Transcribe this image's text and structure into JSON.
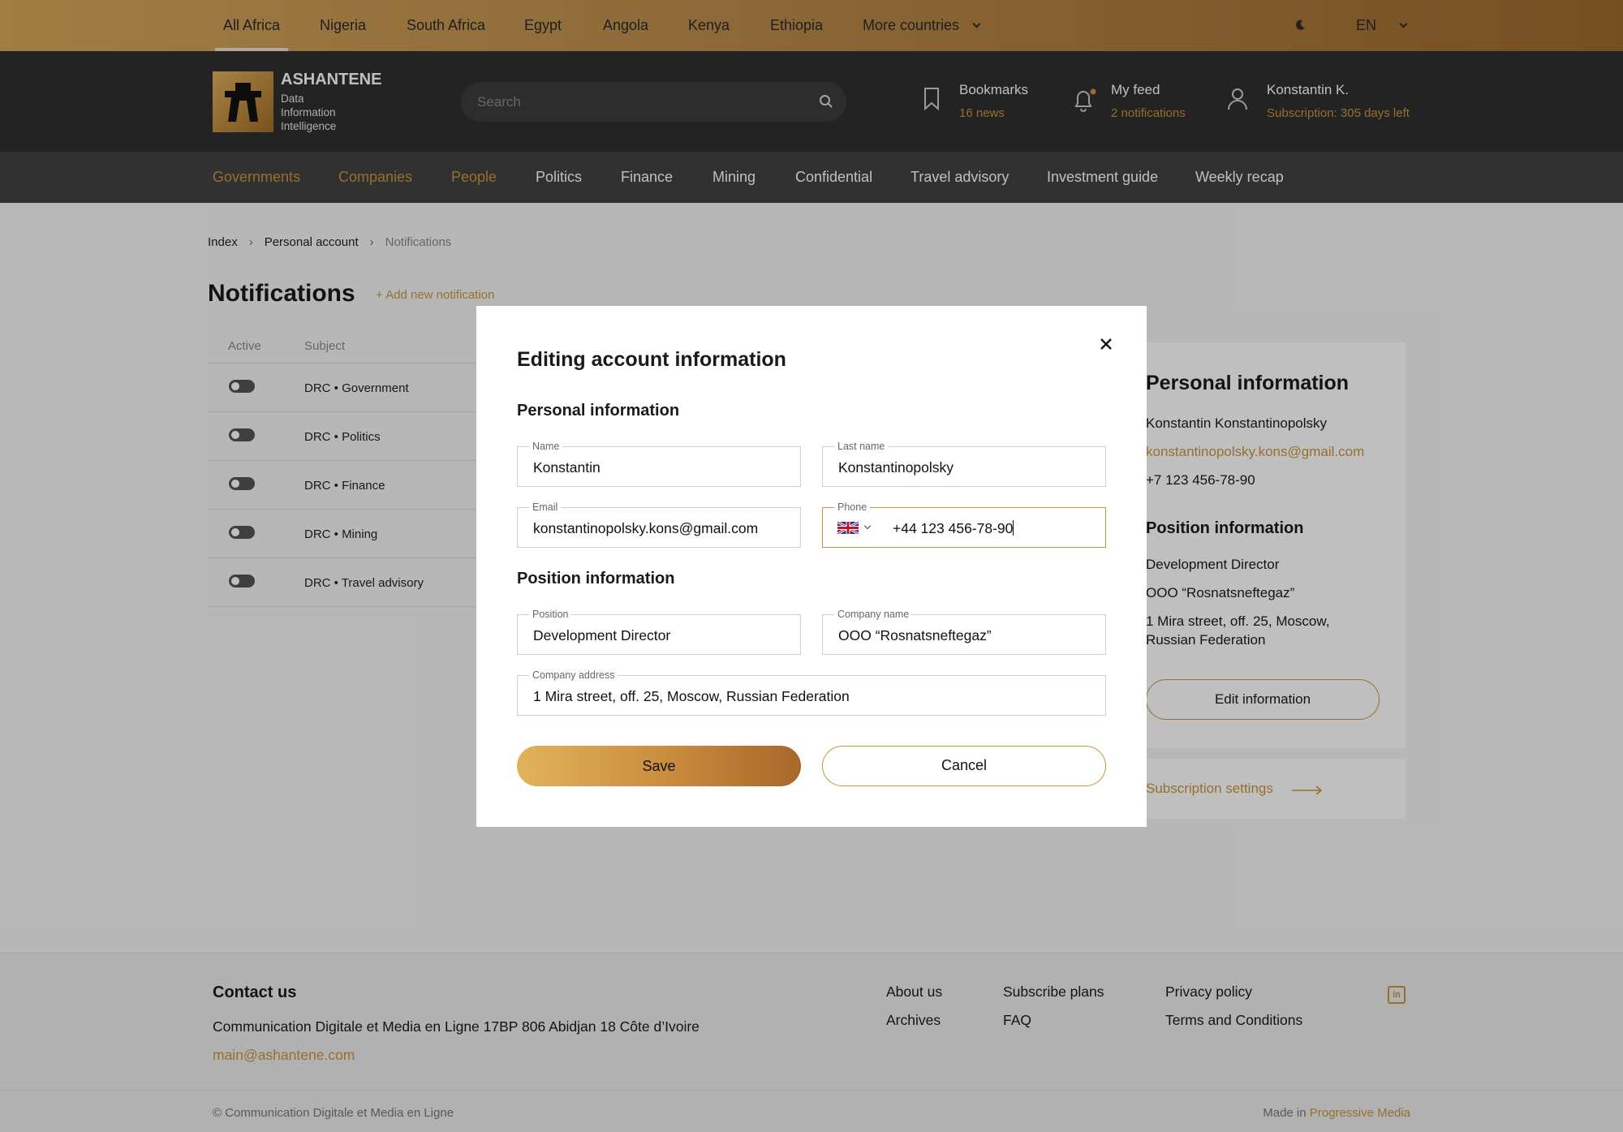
{
  "country_bar": {
    "countries": [
      "All Africa",
      "Nigeria",
      "South Africa",
      "Egypt",
      "Angola",
      "Kenya",
      "Ethiopia"
    ],
    "more_label": "More countries",
    "language": "EN"
  },
  "header": {
    "brand": "ASHANTENE",
    "tagline": [
      "Data",
      "Information",
      "Intelligence"
    ],
    "search_placeholder": "Search",
    "bookmarks": {
      "title": "Bookmarks",
      "sub": "16 news"
    },
    "feed": {
      "title": "My feed",
      "sub": "2 notifications"
    },
    "user": {
      "title": "Konstantin K.",
      "sub": "Subscription: 305 days left"
    }
  },
  "nav": {
    "items": [
      "Governments",
      "Companies",
      "People",
      "Politics",
      "Finance",
      "Mining",
      "Confidential",
      "Travel advisory",
      "Investment guide",
      "Weekly recap"
    ]
  },
  "breadcrumb": [
    "Index",
    "Personal account",
    "Notifications"
  ],
  "notifications": {
    "title": "Notifications",
    "add_label": "+ Add new notification",
    "col_active": "Active",
    "col_subject": "Subject",
    "rows": [
      "DRC • Government",
      "DRC • Politics",
      "DRC • Finance",
      "DRC • Mining",
      "DRC • Travel advisory"
    ]
  },
  "profile": {
    "personal_heading": "Personal information",
    "full_name": "Konstantin Konstantinopolsky",
    "email": "konstantinopolsky.kons@gmail.com",
    "phone": "+7 123 456-78-90",
    "position_heading": "Position information",
    "position": "Development Director",
    "company": "OOO “Rosnatsneftegaz”",
    "address_line1": "1 Mira street, off. 25, Moscow,",
    "address_line2": "Russian Federation",
    "edit_label": "Edit information",
    "subscription_link": "Subscription settings"
  },
  "modal": {
    "title": "Editing account information",
    "personal_heading": "Personal information",
    "position_heading": "Position information",
    "fields": {
      "name": {
        "label": "Name",
        "value": "Konstantin"
      },
      "last_name": {
        "label": "Last name",
        "value": "Konstantinopolsky"
      },
      "email": {
        "label": "Email",
        "value": "konstantinopolsky.kons@gmail.com"
      },
      "phone": {
        "label": "Phone",
        "value": "+44 123 456-78-90"
      },
      "position": {
        "label": "Position",
        "value": "Development Director"
      },
      "company": {
        "label": "Company name",
        "value": "OOO “Rosnatsneftegaz”"
      },
      "address": {
        "label": "Company address",
        "value": "1 Mira street, off. 25, Moscow, Russian Federation"
      }
    },
    "save_label": "Save",
    "cancel_label": "Cancel"
  },
  "footer": {
    "contact_heading": "Contact us",
    "address": "Communication Digitale et Media en Ligne 17BP 806 Abidjan 18 Côte d’Ivoire",
    "email": "main@ashantene.com",
    "links": [
      "About us",
      "Archives",
      "Subscribe plans",
      "FAQ",
      "Privacy policy",
      "Terms and Conditions"
    ],
    "copyright": "© Communication Digitale et Media en Ligne",
    "made_in": "Made in",
    "made_by": "Progressive Media"
  },
  "colors": {
    "accent": "#c8953f",
    "header_bg": "#2f2f2f",
    "nav_bg": "#424242"
  },
  "icons": [
    "moon-icon",
    "chevron-down-icon",
    "search-icon",
    "bookmark-icon",
    "bell-icon",
    "user-icon",
    "close-icon",
    "uk-flag-icon",
    "arrow-right-icon",
    "linkedin-icon"
  ]
}
